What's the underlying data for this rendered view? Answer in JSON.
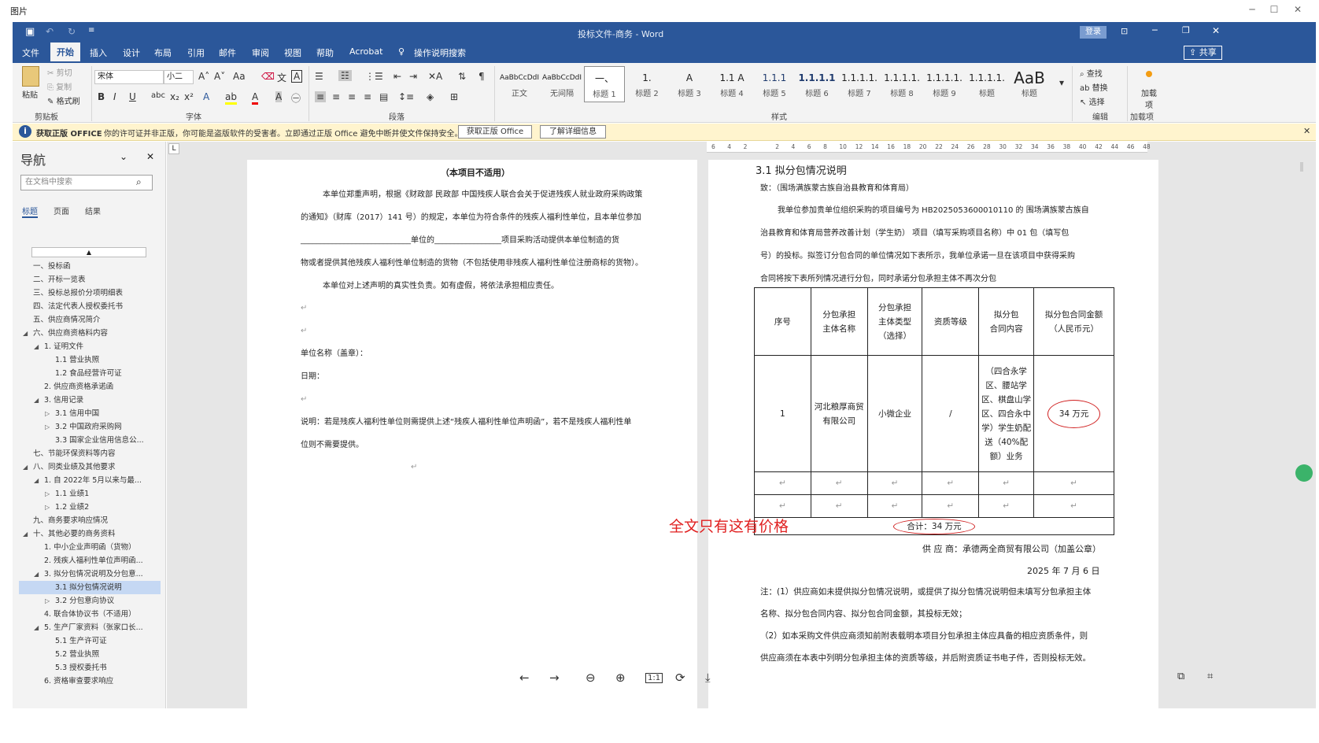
{
  "viewer": {
    "title": "图片"
  },
  "word": {
    "window_title": "投标文件-商务  -  Word",
    "login_label": "登录",
    "share_label": "共享",
    "tabs": [
      "文件",
      "开始",
      "插入",
      "设计",
      "布局",
      "引用",
      "邮件",
      "审阅",
      "视图",
      "帮助",
      "Acrobat"
    ],
    "tell_me": "操作说明搜索",
    "ribbon": {
      "clipboard": {
        "paste": "粘贴",
        "cut": "剪切",
        "copy": "复制",
        "format_painter": "格式刷",
        "label": "剪贴板"
      },
      "font": {
        "name": "宋体",
        "size": "小二",
        "label": "字体"
      },
      "paragraph": {
        "label": "段落"
      },
      "styles": {
        "label": "样式",
        "items": [
          {
            "sample": "AaBbCcDdI",
            "name": "正文"
          },
          {
            "sample": "AaBbCcDdI",
            "name": "无间隔"
          },
          {
            "sample": "一、",
            "name": "标题 1"
          },
          {
            "sample": "1.",
            "name": "标题 2"
          },
          {
            "sample": "A",
            "name": "标题 3"
          },
          {
            "sample": "1.1 A",
            "name": "标题 4"
          },
          {
            "sample": "1.1.1",
            "name": "标题 5"
          },
          {
            "sample": "1.1.1.1",
            "name": "标题 6"
          },
          {
            "sample": "1.1.1.1.",
            "name": "标题 7"
          },
          {
            "sample": "1.1.1.1.",
            "name": "标题 8"
          },
          {
            "sample": "1.1.1.1.",
            "name": "标题 9"
          },
          {
            "sample": "1.1.1.1.",
            "name": "标题"
          },
          {
            "sample": "AaB",
            "name": "标题"
          }
        ]
      },
      "editing": {
        "find": "查找",
        "replace": "替换",
        "select": "选择",
        "label": "编辑"
      },
      "addins": {
        "add": "加载项",
        "label": "加载项"
      }
    },
    "message_bar": {
      "title": "获取正版 OFFICE",
      "text": "你的许可证并非正版，你可能是盗版软件的受害者。立即通过正版 Office 避免中断并使文件保持安全。",
      "btn1": "获取正版 Office",
      "btn2": "了解详细信息"
    },
    "nav": {
      "title": "导航",
      "search_placeholder": "在文档中搜索",
      "tabs": [
        "标题",
        "页面",
        "结果"
      ],
      "items": [
        {
          "text": "一、投标函",
          "level": 1
        },
        {
          "text": "二、开标一览表",
          "level": 1
        },
        {
          "text": "三、投标总报价分项明细表",
          "level": 1
        },
        {
          "text": "四、法定代表人授权委托书",
          "level": 1
        },
        {
          "text": "五、供应商情况简介",
          "level": 1
        },
        {
          "text": "六、供应商资格料内容",
          "level": 1,
          "expand": "down"
        },
        {
          "text": "1. 证明文件",
          "level": 2,
          "expand": "down"
        },
        {
          "text": "1.1 营业执照",
          "level": 3
        },
        {
          "text": "1.2 食品经营许可证",
          "level": 3
        },
        {
          "text": "2. 供应商资格承诺函",
          "level": 2
        },
        {
          "text": "3. 信用记录",
          "level": 2,
          "expand": "down"
        },
        {
          "text": "3.1 信用中国",
          "level": 3,
          "expand": "right"
        },
        {
          "text": "3.2 中国政府采购网",
          "level": 3,
          "expand": "right"
        },
        {
          "text": "3.3 国家企业信用信息公...",
          "level": 3
        },
        {
          "text": "七、节能环保资料等内容",
          "level": 1
        },
        {
          "text": "八、同类业绩及其他要求",
          "level": 1,
          "expand": "down"
        },
        {
          "text": "1. 自 2022年 5月以来与最...",
          "level": 2,
          "expand": "down"
        },
        {
          "text": "1.1 业绩1",
          "level": 3,
          "expand": "right"
        },
        {
          "text": "1.2 业绩2",
          "level": 3,
          "expand": "right"
        },
        {
          "text": "九、商务要求响应情况",
          "level": 1
        },
        {
          "text": "十、其他必要的商务资料",
          "level": 1,
          "expand": "down"
        },
        {
          "text": "1. 中小企业声明函（货物）",
          "level": 2
        },
        {
          "text": "2. 残疾人福利性单位声明函...",
          "level": 2
        },
        {
          "text": "3. 拟分包情况说明及分包意...",
          "level": 2,
          "expand": "down"
        },
        {
          "text": "3.1 拟分包情况说明",
          "level": 3,
          "selected": true
        },
        {
          "text": "3.2 分包意向协议",
          "level": 3,
          "expand": "right"
        },
        {
          "text": "4. 联合体协议书（不适用）",
          "level": 2
        },
        {
          "text": "5. 生产厂家资料（张家口长...",
          "level": 2,
          "expand": "down"
        },
        {
          "text": "5.1 生产许可证",
          "level": 3
        },
        {
          "text": "5.2 营业执照",
          "level": 3
        },
        {
          "text": "5.3 授权委托书",
          "level": 3
        },
        {
          "text": "6. 资格审查要求响应",
          "level": 2
        }
      ]
    },
    "ruler_ticks": [
      "6",
      "4",
      "2",
      "",
      "2",
      "4",
      "6",
      "8",
      "10",
      "12",
      "14",
      "16",
      "18",
      "20",
      "22",
      "24",
      "26",
      "28",
      "30",
      "32",
      "34",
      "36",
      "38",
      "40",
      "42",
      "44",
      "46",
      "48"
    ],
    "left_page": {
      "title": "（本项目不适用）",
      "lines": [
        "本单位郑重声明，根据《财政部 民政部 中国残疾人联合会关于促进残疾人就业政府采购政策",
        "的通知》（财库（2017）141 号）的规定，本单位为符合条件的残疾人福利性单位，且本单位参加",
        "____________________________单位的_________________项目采购活动提供本单位制造的货",
        "物或者提供其他残疾人福利性单位制造的货物（不包括使用非残疾人福利性单位注册商标的货物）。",
        "本单位对上述声明的真实性负责。如有虚假，将依法承担相应责任。",
        "单位名称（盖章）：",
        "日期：",
        "说明：若是残疾人福利性单位则需提供上述“残疾人福利性单位声明函”，若不是残疾人福利性单",
        "位则不需要提供。"
      ]
    },
    "right_page": {
      "heading": "3.1   拟分包情况说明",
      "to_line": "致：（围场满族蒙古族自治县教育和体育局）",
      "para_lines": [
        "我单位参加贵单位组织采购的项目编号为 HB2025053600010110 的 围场满族蒙古族自",
        "治县教育和体育局营养改善计划（学生奶） 项目（填写采购项目名称）中 01 包（填写包",
        "号）的投标。拟签订分包合同的单位情况如下表所示，我单位承诺一旦在该项目中获得采购",
        "合同将按下表所列情况进行分包，同时承诺分包承担主体不再次分包"
      ],
      "table": {
        "headers": [
          [
            "序号"
          ],
          [
            "分包承担",
            "主体名称"
          ],
          [
            "分包承担",
            "主体类型",
            "（选择）"
          ],
          [
            "资质等级"
          ],
          [
            "拟分包",
            "合同内容"
          ],
          [
            "拟分包合同金额",
            "（人民币元）"
          ]
        ],
        "row1": {
          "no": "1",
          "name": "河北粮厚商贸有限公司",
          "type": "小微企业",
          "grade": "/",
          "content": "（四合永学区、腰站学区、棋盘山学区、四合永中学）学生奶配送（40%配额）业务",
          "amount": "34 万元"
        },
        "total": "合计：34 万元"
      },
      "supplier": "供 应 商：承德两全商贸有限公司（加盖公章）",
      "date": "2025 年 7 月 6 日",
      "notes": [
        "注：(1）供应商如未提供拟分包情况说明，或提供了拟分包情况说明但未填写分包承担主体",
        "名称、拟分包合同内容、拟分包合同金额，其投标无效；",
        "（2）如本采购文件供应商须知前附表载明本项目分包承担主体应具备的相应资质条件，则",
        "供应商须在本表中列明分包承担主体的资质等级，并后附资质证书电子件，否则投标无效。"
      ]
    },
    "annotation": "全文只有这有价格"
  },
  "colors": {
    "word_blue": "#2b579a",
    "annotation_red": "#e02020",
    "message_bar": "#fff4ce"
  }
}
